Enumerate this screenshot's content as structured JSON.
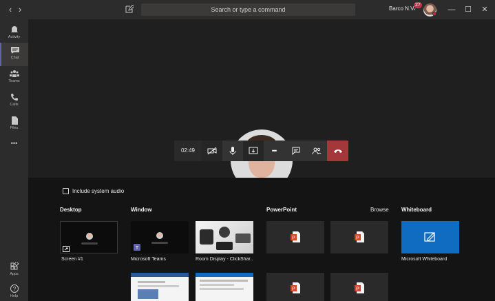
{
  "titlebar": {
    "search_placeholder": "Search or type a command",
    "org_name": "Barco N.V.",
    "notification_count": "27"
  },
  "rail": {
    "items": [
      {
        "label": "Activity",
        "icon": "bell-icon"
      },
      {
        "label": "Chat",
        "icon": "chat-icon",
        "active": true
      },
      {
        "label": "Teams",
        "icon": "teams-icon"
      },
      {
        "label": "Calls",
        "icon": "phone-icon"
      },
      {
        "label": "Files",
        "icon": "file-icon"
      }
    ],
    "more_label": "•••",
    "apps_label": "Apps",
    "help_label": "Help"
  },
  "call": {
    "timer": "02:49",
    "more_label": "•••"
  },
  "share": {
    "include_audio_label": "Include system audio",
    "sections": {
      "desktop": "Desktop",
      "window": "Window",
      "powerpoint": "PowerPoint",
      "browse": "Browse",
      "whiteboard": "Whiteboard"
    },
    "desktop_items": [
      {
        "caption": "Screen #1"
      }
    ],
    "window_items": [
      {
        "caption": "Microsoft Teams"
      },
      {
        "caption": "Room Display - ClickShar..."
      }
    ],
    "whiteboard_items": [
      {
        "caption": "Microsoft Whiteboard"
      }
    ]
  },
  "colors": {
    "accent": "#6264a7",
    "hangup": "#a4373a",
    "whiteboard": "#0f6cc0",
    "powerpoint": "#d24726"
  }
}
